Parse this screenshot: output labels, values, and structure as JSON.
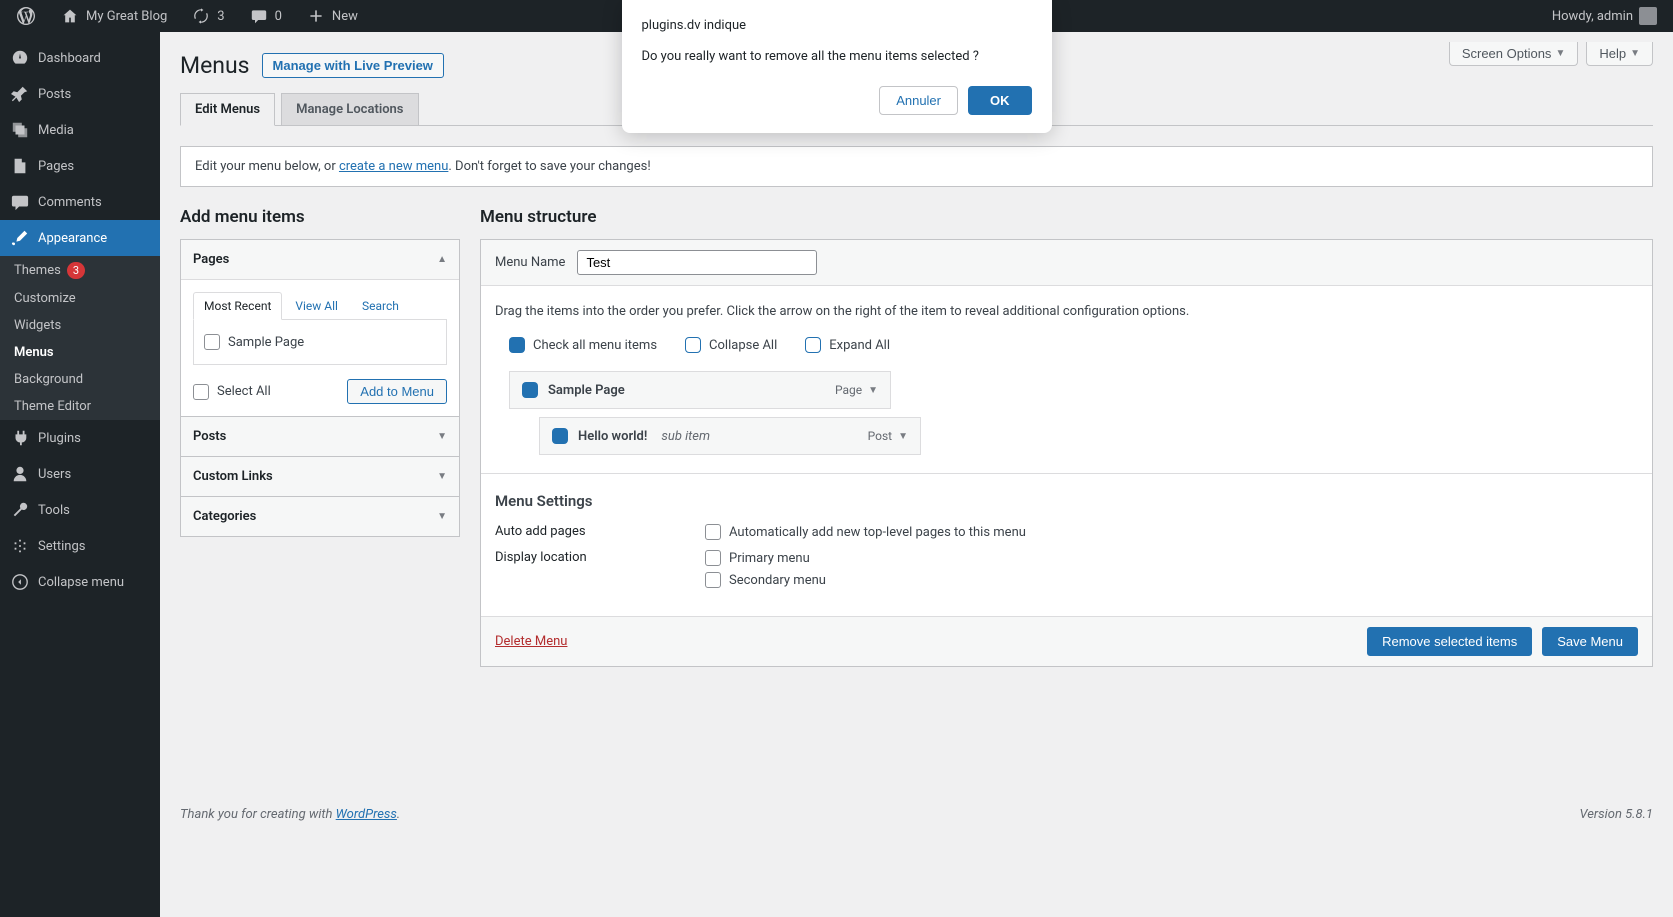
{
  "adminbar": {
    "site_name": "My Great Blog",
    "updates_count": "3",
    "comments_count": "0",
    "new_label": "New",
    "howdy": "Howdy, admin"
  },
  "sidebar": {
    "dashboard": "Dashboard",
    "posts": "Posts",
    "media": "Media",
    "pages": "Pages",
    "comments": "Comments",
    "appearance": "Appearance",
    "appearance_sub": {
      "themes": "Themes",
      "themes_badge": "3",
      "customize": "Customize",
      "widgets": "Widgets",
      "menus": "Menus",
      "background": "Background",
      "theme_editor": "Theme Editor"
    },
    "plugins": "Plugins",
    "users": "Users",
    "tools": "Tools",
    "settings": "Settings",
    "collapse": "Collapse menu"
  },
  "top_buttons": {
    "screen_options": "Screen Options",
    "help": "Help"
  },
  "page": {
    "title": "Menus",
    "preview_btn": "Manage with Live Preview",
    "tabs": {
      "edit": "Edit Menus",
      "locations": "Manage Locations"
    },
    "info_prefix": "Edit your menu below, or ",
    "info_link": "create a new menu",
    "info_suffix": ". Don't forget to save your changes!"
  },
  "add_items": {
    "heading": "Add menu items",
    "pages": {
      "title": "Pages",
      "tabs": {
        "recent": "Most Recent",
        "view_all": "View All",
        "search": "Search"
      },
      "items": [
        {
          "label": "Sample Page"
        }
      ],
      "select_all": "Select All",
      "add_btn": "Add to Menu"
    },
    "posts": "Posts",
    "custom_links": "Custom Links",
    "categories": "Categories"
  },
  "structure": {
    "heading": "Menu structure",
    "name_label": "Menu Name",
    "name_value": "Test",
    "desc": "Drag the items into the order you prefer. Click the arrow on the right of the item to reveal additional configuration options.",
    "bulk": {
      "check_all": "Check all menu items",
      "collapse": "Collapse All",
      "expand": "Expand All"
    },
    "items": [
      {
        "title": "Sample Page",
        "type": "Page",
        "sub": false
      },
      {
        "title": "Hello world!",
        "type": "Post",
        "sub": true,
        "subtext": "sub item"
      }
    ],
    "settings_heading": "Menu Settings",
    "auto_add_label": "Auto add pages",
    "auto_add_opt": "Automatically add new top-level pages to this menu",
    "display_loc_label": "Display location",
    "loc_primary": "Primary menu",
    "loc_secondary": "Secondary menu",
    "delete": "Delete Menu",
    "remove_selected": "Remove selected items",
    "save": "Save Menu"
  },
  "footer": {
    "thanks_prefix": "Thank you for creating with ",
    "thanks_link": "WordPress",
    "version": "Version 5.8.1"
  },
  "dialog": {
    "title": "plugins.dv indique",
    "message": "Do you really want to remove all the menu items selected ?",
    "cancel": "Annuler",
    "ok": "OK"
  }
}
